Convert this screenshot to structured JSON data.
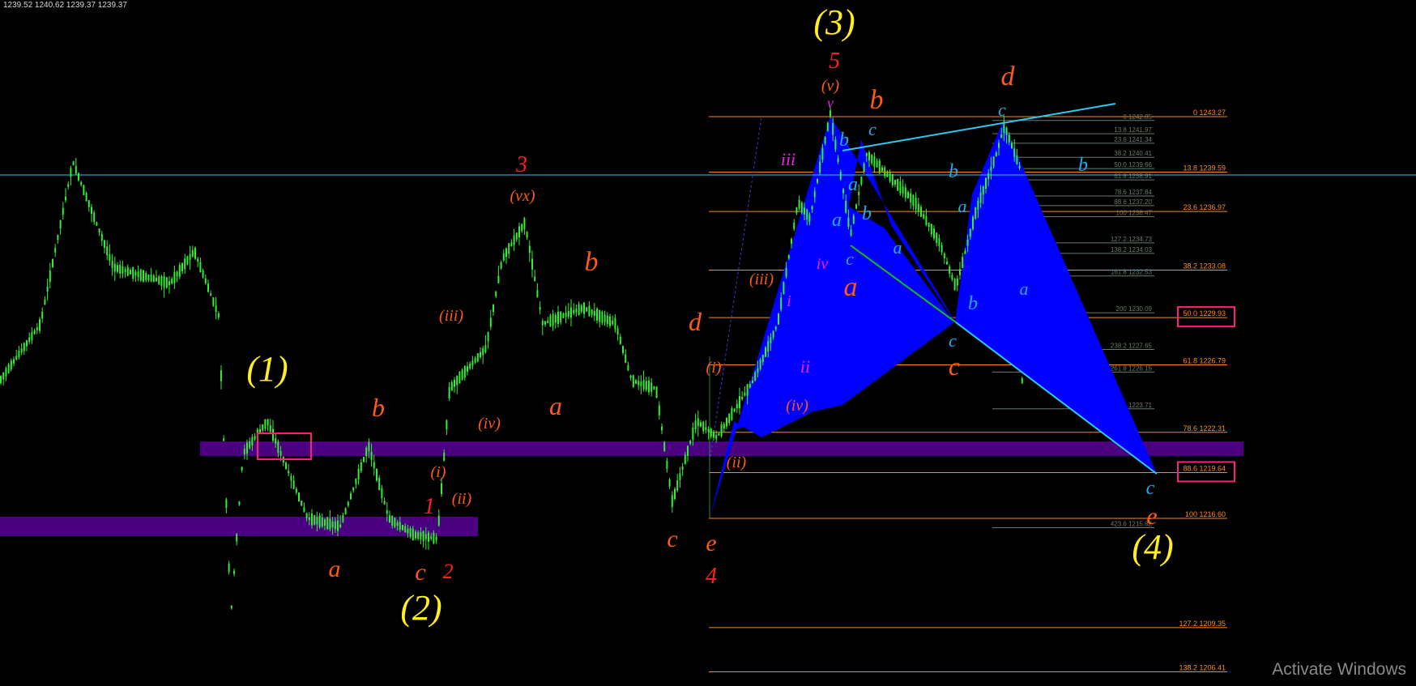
{
  "header": {
    "ohlc": "1239.52 1240.62 1239.37 1239.37"
  },
  "watermark": "Activate Windows",
  "colors": {
    "background": "#000000",
    "candle": "#33ee33",
    "fib_primary": "#ff8c1a",
    "fib_secondary": "#6b7a6b",
    "highlight_box": "#ff1f7a",
    "zone": "#4b0082",
    "pattern_fill": "#0000ff",
    "trendline": "#2ec8f0",
    "support_line": "#16c016",
    "label_yellow": "#ffee22",
    "label_orange": "#ff5a14",
    "label_red": "#ff2020",
    "label_magenta": "#ee22ee",
    "label_blue": "#22aaee"
  },
  "chart_data": {
    "type": "candlestick",
    "title": "",
    "xlabel": "",
    "ylabel": "",
    "price_line": 1239.37,
    "fib_primary": [
      {
        "label": "0 1243.27"
      },
      {
        "label": "13.8 1239.59"
      },
      {
        "label": "23.6 1236.97"
      },
      {
        "label": "38.2 1233.08"
      },
      {
        "label": "50.0 1229.93",
        "boxed": true
      },
      {
        "label": "61.8 1226.79"
      },
      {
        "label": "78.6 1222.31"
      },
      {
        "label": "88.6 1219.64",
        "boxed": true
      },
      {
        "label": "100 1216.60"
      },
      {
        "label": "127.2 1209.35"
      },
      {
        "label": "138.2 1206.41"
      }
    ],
    "fib_secondary": [
      {
        "label": "0 1242.85"
      },
      {
        "label": "13.8 1241.97"
      },
      {
        "label": "23.6 1241.34"
      },
      {
        "label": "38.2 1240.41"
      },
      {
        "label": "50.0 1239.66"
      },
      {
        "label": "61.8 1238.91"
      },
      {
        "label": "78.6 1237.84"
      },
      {
        "label": "88.6 1237.20"
      },
      {
        "label": "100 1236.47"
      },
      {
        "label": "127.2 1234.73"
      },
      {
        "label": "138.2 1234.03"
      },
      {
        "label": "161.8 1232.53"
      },
      {
        "label": "200 1230.09"
      },
      {
        "label": "238.2 1227.65"
      },
      {
        "label": "261.8 1226.15"
      },
      {
        "label": "300 1223.71"
      },
      {
        "label": "423.6 1215.82"
      }
    ],
    "wave_labels": {
      "yellow": [
        "(1)",
        "(2)",
        "(3)",
        "(4)"
      ],
      "red": [
        "1",
        "2",
        "3",
        "4",
        "5"
      ],
      "orange": [
        "a",
        "b",
        "c",
        "(i)",
        "(ii)",
        "(iii)",
        "(iv)",
        "(vx)",
        "b",
        "a",
        "d",
        "c",
        "e",
        "(i)",
        "(ii)",
        "(iii)",
        "(iv)",
        "(v)",
        "b",
        "a",
        "d",
        "c",
        "e"
      ],
      "magenta": [
        "v",
        "iii",
        "iv",
        "i",
        "ii"
      ],
      "blue": [
        "b",
        "a",
        "a",
        "c",
        "b",
        "c",
        "a",
        "b",
        "a",
        "b",
        "c",
        "c",
        "b",
        "a",
        "c"
      ]
    }
  }
}
